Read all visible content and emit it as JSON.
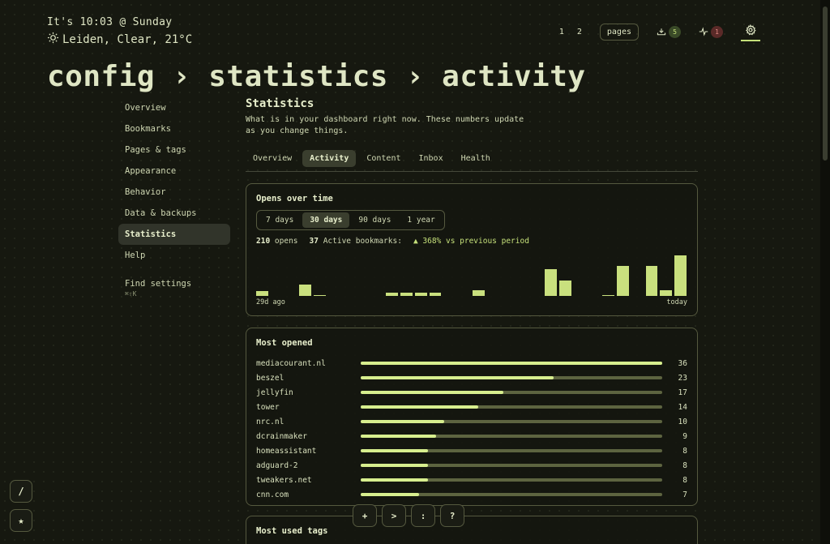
{
  "header": {
    "clock": "It's 10:03 @ Sunday",
    "weather": "Leiden, Clear, 21°C",
    "weather_icon": "sun-icon"
  },
  "topnav": {
    "page1": "1",
    "page2": "2",
    "pages_button": "pages",
    "inbox_count": "5",
    "health_count": "1"
  },
  "breadcrumb": [
    "config",
    "statistics",
    "activity"
  ],
  "breadcrumb_sep": "›",
  "sidebar": {
    "items": [
      {
        "label": "Overview"
      },
      {
        "label": "Bookmarks"
      },
      {
        "label": "Pages & tags"
      },
      {
        "label": "Appearance"
      },
      {
        "label": "Behavior"
      },
      {
        "label": "Data & backups"
      },
      {
        "label": "Statistics",
        "active": true
      },
      {
        "label": "Help"
      }
    ],
    "find_label": "Find settings",
    "find_shortcut": "⌘⇧K"
  },
  "main": {
    "title": "Statistics",
    "description": "What is in your dashboard right now. These numbers update as you change things.",
    "tabs": [
      {
        "label": "Overview"
      },
      {
        "label": "Activity",
        "active": true
      },
      {
        "label": "Content"
      },
      {
        "label": "Inbox"
      },
      {
        "label": "Health"
      }
    ]
  },
  "opens_card": {
    "title": "Opens over time",
    "ranges": [
      {
        "label": "7 days"
      },
      {
        "label": "30 days",
        "active": true
      },
      {
        "label": "90 days"
      },
      {
        "label": "1 year"
      }
    ],
    "opens_count": "210",
    "opens_label": "opens",
    "active_count": "37",
    "active_label": "Active bookmarks:",
    "delta": "▲ 368% vs previous period",
    "start_label": "29d ago",
    "end_label": "today"
  },
  "chart_data": {
    "type": "bar",
    "title": "Opens over time",
    "x_start_label": "29d ago",
    "x_end_label": "today",
    "values": [
      2,
      0,
      0,
      5,
      0.5,
      0,
      0,
      0,
      0,
      1.5,
      1.5,
      1.5,
      1.5,
      0,
      0,
      2.5,
      0,
      0,
      0,
      0,
      12,
      7,
      0,
      0,
      0.5,
      13.5,
      0,
      13.5,
      2.5,
      18
    ],
    "ylim": [
      0,
      18
    ]
  },
  "most_opened": {
    "title": "Most opened",
    "max": 36,
    "rows": [
      {
        "name": "mediacourant.nl",
        "count": 36
      },
      {
        "name": "beszel",
        "count": 23
      },
      {
        "name": "jellyfin",
        "count": 17
      },
      {
        "name": "tower",
        "count": 14
      },
      {
        "name": "nrc.nl",
        "count": 10
      },
      {
        "name": "dcrainmaker",
        "count": 9
      },
      {
        "name": "homeassistant",
        "count": 8
      },
      {
        "name": "adguard-2",
        "count": 8
      },
      {
        "name": "tweakers.net",
        "count": 8
      },
      {
        "name": "cnn.com",
        "count": 7
      }
    ]
  },
  "tags_card": {
    "title": "Most used tags"
  },
  "fabs": {
    "search": "/",
    "favorites": "★"
  },
  "dock": {
    "add": "+",
    "command": ">",
    "colon": ":",
    "help": "?"
  },
  "colors": {
    "accent": "#c9e07e",
    "background": "#161810",
    "badge_red": "#e08a82"
  }
}
